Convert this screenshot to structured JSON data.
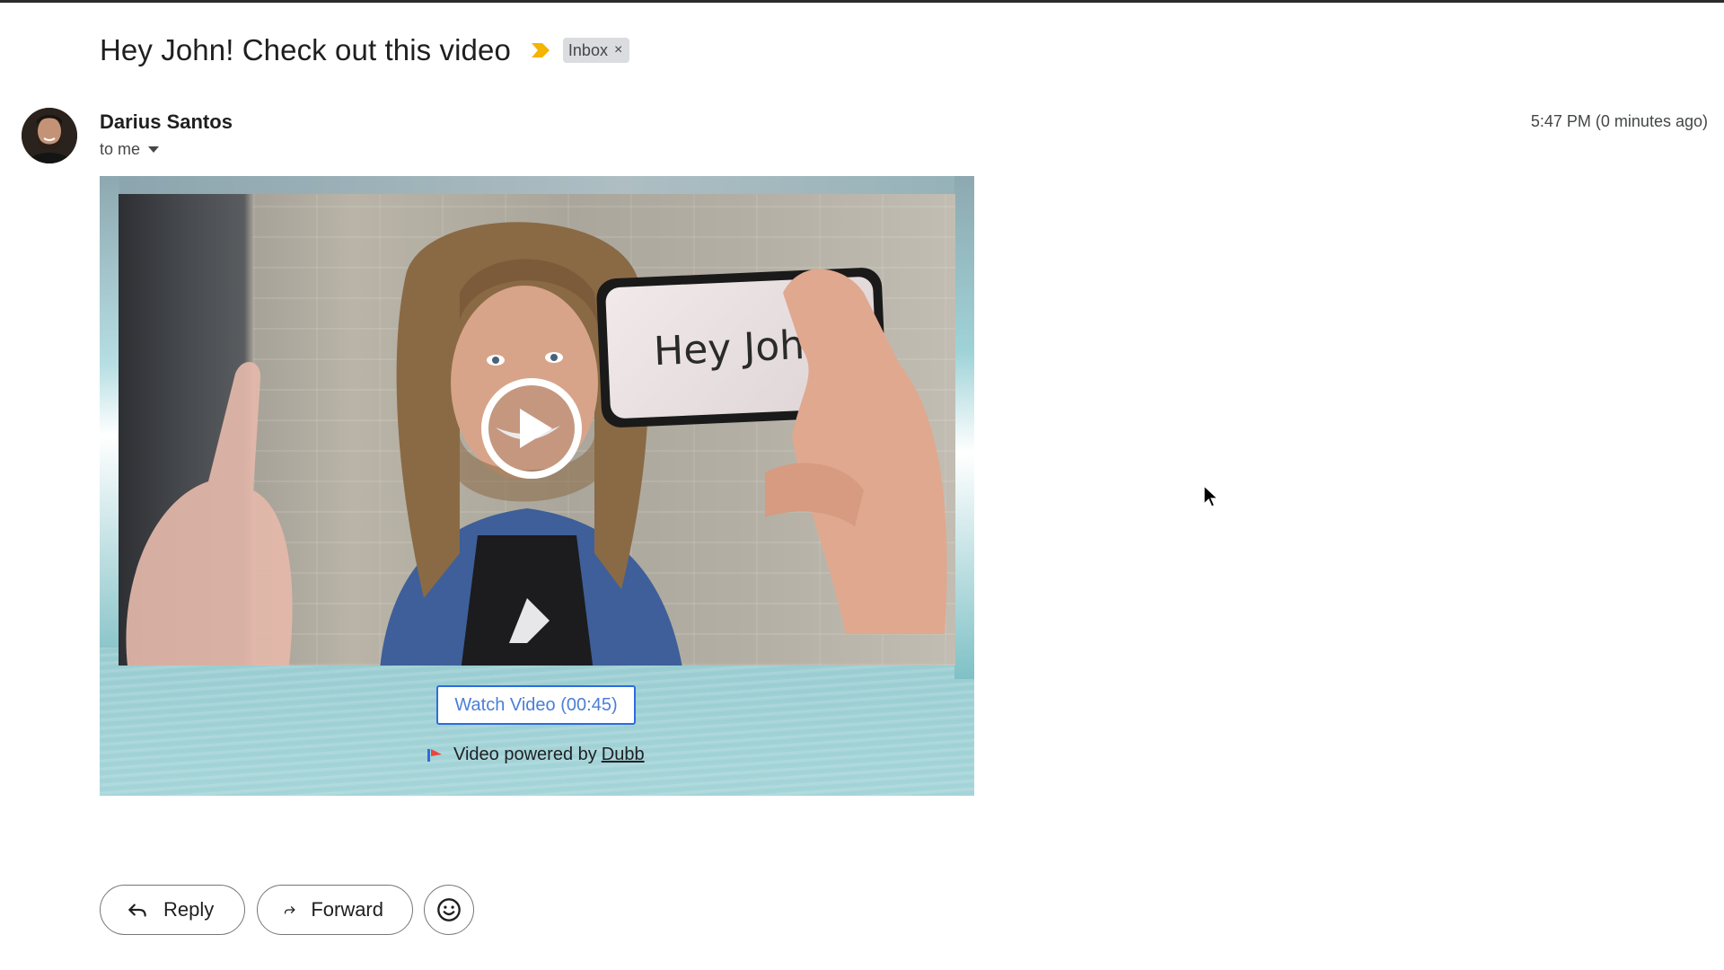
{
  "email": {
    "subject": "Hey John! Check out this video",
    "label": "Inbox",
    "label_remove": "×"
  },
  "sender": {
    "name": "Darius Santos",
    "recipient": "to me",
    "timestamp": "5:47 PM (0 minutes ago)"
  },
  "video": {
    "phone_text": "Hey John",
    "watch_button": "Watch Video (00:45)",
    "powered_prefix": "Video powered by",
    "powered_link": "Dubb"
  },
  "actions": {
    "reply": "Reply",
    "forward": "Forward"
  },
  "icons": {
    "importance": "importance-marker-icon",
    "reply": "reply-arrow-icon",
    "forward": "forward-arrow-icon",
    "emoji": "emoji-smile-icon",
    "play": "play-icon",
    "dubb_logo": "dubb-logo-icon"
  },
  "colors": {
    "importance": "#f4b400",
    "link_blue": "#2d6cdf",
    "chip_bg": "#dadce0"
  }
}
